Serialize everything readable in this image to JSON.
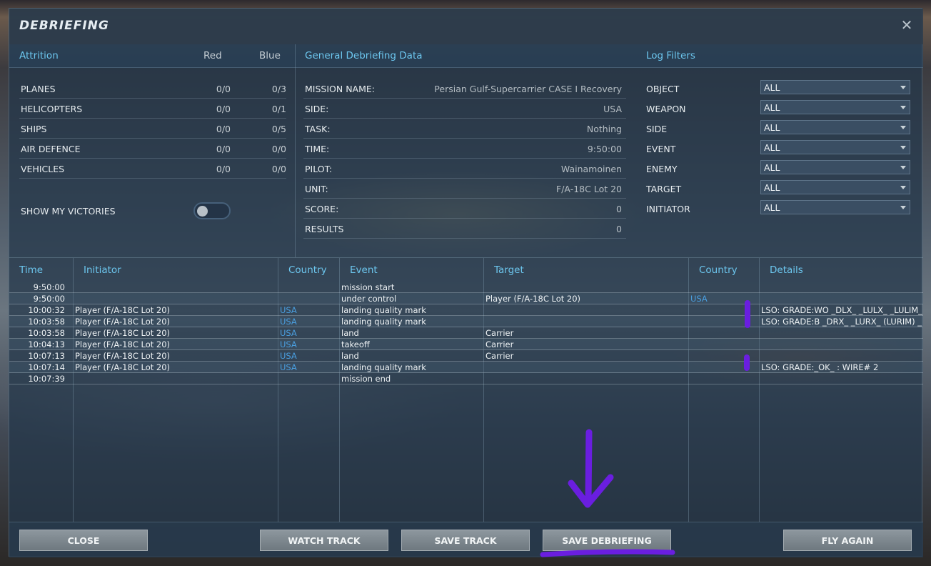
{
  "window": {
    "title": "DEBRIEFING",
    "close_glyph": "✕"
  },
  "attrition": {
    "header": "Attrition",
    "col_red": "Red",
    "col_blue": "Blue",
    "rows": [
      {
        "label": "PLANES",
        "red": "0/0",
        "blue": "0/3"
      },
      {
        "label": "HELICOPTERS",
        "red": "0/0",
        "blue": "0/1"
      },
      {
        "label": "SHIPS",
        "red": "0/0",
        "blue": "0/5"
      },
      {
        "label": "AIR DEFENCE",
        "red": "0/0",
        "blue": "0/0"
      },
      {
        "label": "VEHICLES",
        "red": "0/0",
        "blue": "0/0"
      }
    ],
    "show_my_victories": {
      "label": "SHOW MY VICTORIES",
      "on": false
    }
  },
  "general": {
    "header": "General Debriefing Data",
    "rows": [
      {
        "label": "MISSION NAME:",
        "value": "Persian Gulf-Supercarrier CASE I Recovery"
      },
      {
        "label": "SIDE:",
        "value": "USA"
      },
      {
        "label": "TASK:",
        "value": "Nothing"
      },
      {
        "label": "TIME:",
        "value": "9:50:00"
      },
      {
        "label": "PILOT:",
        "value": "Wainamoinen"
      },
      {
        "label": "UNIT:",
        "value": "F/A-18C Lot 20"
      },
      {
        "label": "SCORE:",
        "value": "0"
      },
      {
        "label": "RESULTS",
        "value": "0"
      }
    ]
  },
  "filters": {
    "header": "Log Filters",
    "rows": [
      {
        "label": "OBJECT",
        "value": "ALL"
      },
      {
        "label": "WEAPON",
        "value": "ALL"
      },
      {
        "label": "SIDE",
        "value": "ALL"
      },
      {
        "label": "EVENT",
        "value": "ALL"
      },
      {
        "label": "ENEMY",
        "value": "ALL"
      },
      {
        "label": "TARGET",
        "value": "ALL"
      },
      {
        "label": "INITIATOR",
        "value": "ALL"
      }
    ]
  },
  "log": {
    "columns": [
      "Time",
      "Initiator",
      "Country",
      "Event",
      "Target",
      "Country",
      "Details"
    ],
    "rows": [
      {
        "time": "9:50:00",
        "initiator": "",
        "country": "",
        "event": "mission start",
        "target": "",
        "tcountry": "",
        "details": ""
      },
      {
        "time": "9:50:00",
        "initiator": "",
        "country": "",
        "event": "under control",
        "target": "Player (F/A-18C Lot 20)",
        "tcountry": "USA",
        "details": ""
      },
      {
        "time": "10:00:32",
        "initiator": "Player (F/A-18C Lot 20)",
        "country": "USA",
        "event": "landing quality mark",
        "target": "",
        "tcountry": "",
        "details": "LSO: GRADE:WO  _DLX_  _LULX_  _LULIM_"
      },
      {
        "time": "10:03:58",
        "initiator": "Player (F/A-18C Lot 20)",
        "country": "USA",
        "event": "landing quality mark",
        "target": "",
        "tcountry": "",
        "details": "LSO: GRADE:B  _DRX_  _LURX_  (LURIM)  _D"
      },
      {
        "time": "10:03:58",
        "initiator": "Player (F/A-18C Lot 20)",
        "country": "USA",
        "event": "land",
        "target": "Carrier",
        "tcountry": "",
        "details": ""
      },
      {
        "time": "10:04:13",
        "initiator": "Player (F/A-18C Lot 20)",
        "country": "USA",
        "event": "takeoff",
        "target": "Carrier",
        "tcountry": "",
        "details": ""
      },
      {
        "time": "10:07:13",
        "initiator": "Player (F/A-18C Lot 20)",
        "country": "USA",
        "event": "land",
        "target": "Carrier",
        "tcountry": "",
        "details": ""
      },
      {
        "time": "10:07:14",
        "initiator": "Player (F/A-18C Lot 20)",
        "country": "USA",
        "event": "landing quality mark",
        "target": "",
        "tcountry": "",
        "details": "LSO: GRADE:_OK_ : WIRE# 2"
      },
      {
        "time": "10:07:39",
        "initiator": "",
        "country": "",
        "event": "mission end",
        "target": "",
        "tcountry": "",
        "details": ""
      }
    ]
  },
  "buttons": {
    "close": "CLOSE",
    "watch_track": "WATCH TRACK",
    "save_track": "SAVE TRACK",
    "save_debriefing": "SAVE DEBRIEFING",
    "fly_again": "FLY AGAIN"
  },
  "colors": {
    "accent": "#6cc6ee",
    "country": "#4a9fe0",
    "annotation": "#6a1ee0"
  }
}
